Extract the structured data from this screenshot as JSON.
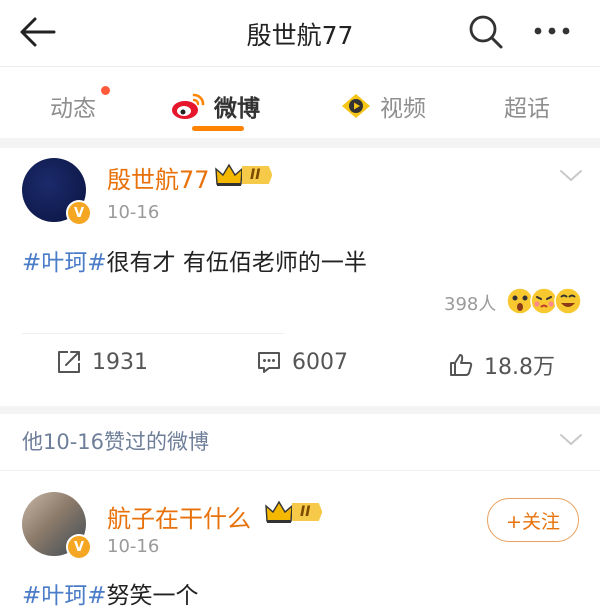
{
  "header": {
    "title": "殷世航77",
    "back_icon": "back-arrow-icon",
    "search_icon": "search-icon",
    "more_icon": "more-icon"
  },
  "tabs": [
    {
      "label": "动态",
      "has_dot": true
    },
    {
      "label": "微博",
      "active": true,
      "icon": "weibo-logo-icon"
    },
    {
      "label": "视频",
      "icon": "video-icon"
    },
    {
      "label": "超话"
    }
  ],
  "post": {
    "username": "殷世航77",
    "vip_level": "II",
    "date": "10-16",
    "topic": "#叶珂#",
    "text": "很有才 有伍佰老师的一半",
    "reaction_count": "398人",
    "actions": {
      "repost": "1931",
      "comment": "6007",
      "like": "18.8万"
    }
  },
  "liked_section": {
    "header": "他10-16赞过的微博"
  },
  "liked_post": {
    "username": "航子在干什么",
    "vip_level": "II",
    "date": "10-16",
    "follow_label": "+关注",
    "topic": "#叶珂#",
    "text_partial": "努笑一个"
  },
  "colors": {
    "accent": "#ff8200",
    "username": "#e8710a",
    "topic": "#4a7cc7",
    "crown": "#f5b800"
  }
}
